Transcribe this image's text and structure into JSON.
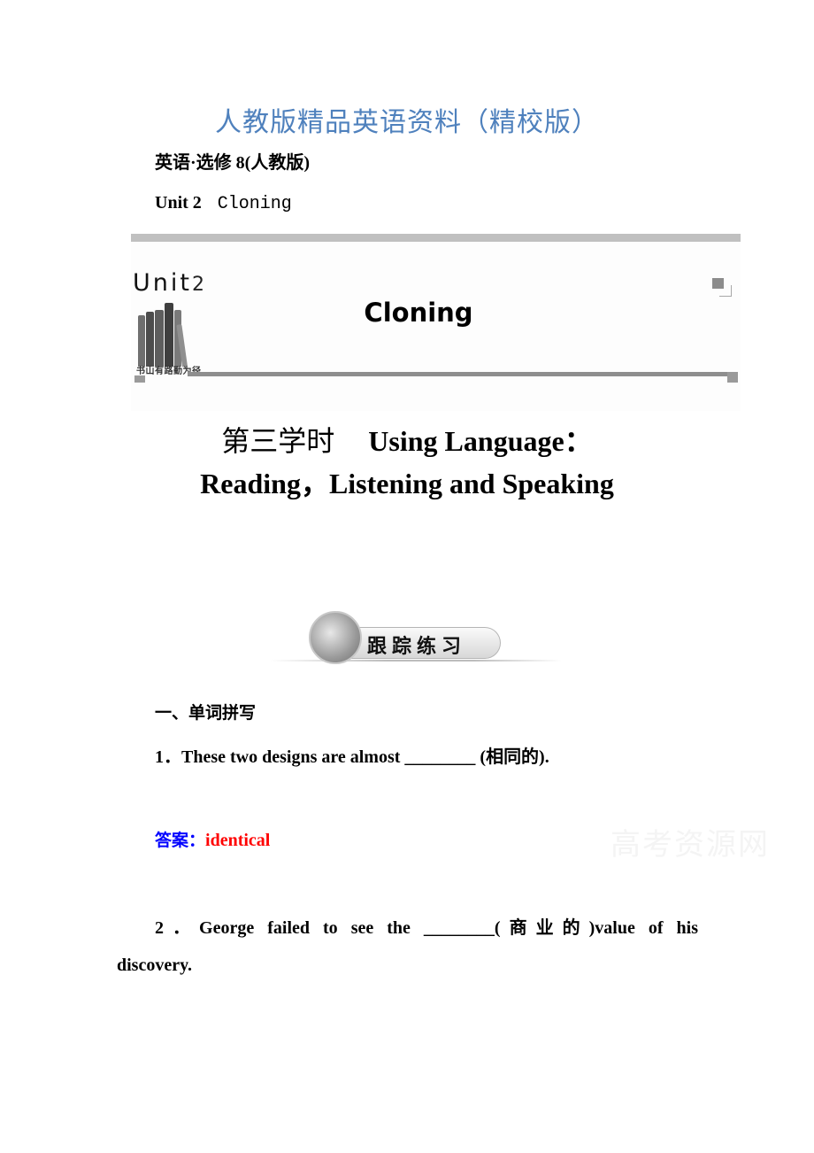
{
  "document": {
    "title": "人教版精品英语资料（精校版）",
    "subject_line": "英语·选修 8(人教版)",
    "unit_label": "Unit 2",
    "unit_topic": "Cloning",
    "title_color": "#4f81bd"
  },
  "banner": {
    "unit_word": "Unit",
    "unit_number": "2",
    "motto": "书山有路勤为径",
    "title": "Cloning",
    "icons": [
      "books-icon",
      "corner-squares-icon"
    ]
  },
  "lesson": {
    "period": "第三学时",
    "line1_en": "Using Language：",
    "line2": "Reading，Listening and Speaking"
  },
  "practice_header": {
    "label": "跟踪练习",
    "icon": "climber-icon"
  },
  "exercises": {
    "section_title": "一、单词拼写",
    "items": [
      {
        "number": "1．",
        "text": "These two designs are almost ________ (相同的).",
        "answer_label": "答案：",
        "answer": "identical"
      },
      {
        "number": "2．",
        "text_line1": "George failed to see the ________(商业的)value of his",
        "text_line2": "discovery."
      }
    ],
    "answer_label_color": "#0000ff",
    "answer_color": "#ff0000"
  },
  "watermark": "高考资源网"
}
